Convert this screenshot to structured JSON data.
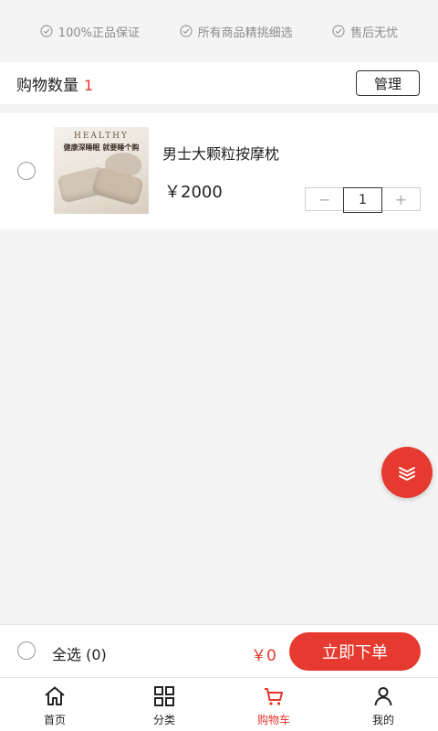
{
  "guarantees": [
    {
      "icon": "check-circle-icon",
      "text": "100%正品保证"
    },
    {
      "icon": "check-circle-icon",
      "text": "所有商品精挑细选"
    },
    {
      "icon": "check-circle-icon",
      "text": "售后无忧"
    }
  ],
  "cart_header": {
    "label": "购物数量",
    "count": "1",
    "manage_label": "管理"
  },
  "cart_items": [
    {
      "title": "男士大颗粒按摩枕",
      "price": "￥2000",
      "quantity": "1",
      "minus": "−",
      "plus": "+",
      "thumb_text_en": "HEALTHY",
      "thumb_text_cn": "健康深睡眠 就要睡个购"
    }
  ],
  "checkout": {
    "select_all_label": "全选 (0)",
    "total": "￥0",
    "order_label": "立即下单"
  },
  "tabs": [
    {
      "label": "首页",
      "icon": "home-icon"
    },
    {
      "label": "分类",
      "icon": "grid-icon"
    },
    {
      "label": "购物车",
      "icon": "cart-icon"
    },
    {
      "label": "我的",
      "icon": "user-icon"
    }
  ],
  "colors": {
    "accent": "#e6392f",
    "muted_text": "#8c8c8c",
    "background": "#f4f4f4"
  }
}
